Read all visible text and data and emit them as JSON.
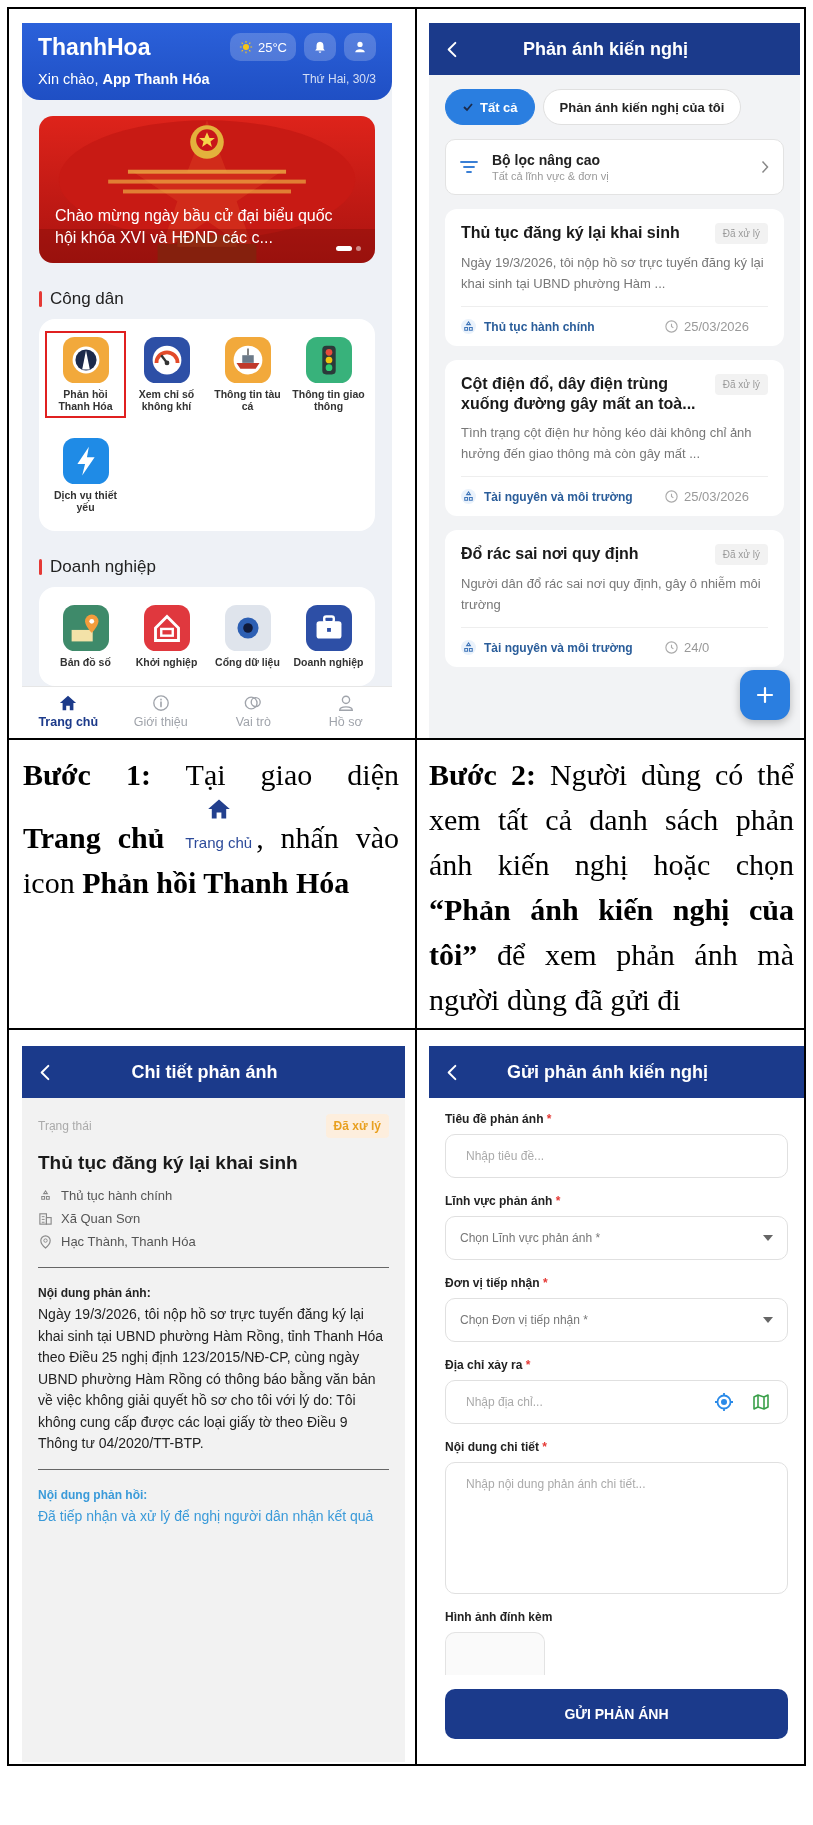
{
  "home_screen": {
    "app_title": "ThanhHoa",
    "weather": "25°C",
    "greeting": "Xin chào, **App Thanh Hóa**",
    "date": "Thứ Hai, 30/3",
    "banner": {
      "kind": "picture",
      "caption": "Chào mừng ngày bầu cử đại biểu quốc hội khóa XVI và HĐND các c...",
      "slides": [
        {
          "selected": true
        },
        {
          "selected": false
        }
      ]
    },
    "sections": [
      {
        "title": "Công dân",
        "services": [
          {
            "label": "Phản hồi Thanh Hóa",
            "highlighted": true,
            "color": "#f2a93b"
          },
          {
            "label": "Xem chỉ số không khí",
            "highlighted": false,
            "color": "#2d4fa6"
          },
          {
            "label": "Thông tin tàu cá",
            "highlighted": false,
            "color": "#f2a93b"
          },
          {
            "label": "Thông tin giao thông",
            "highlighted": false,
            "color": "#38b27b"
          },
          {
            "label": "Dịch vụ thiết yếu",
            "highlighted": false,
            "color": "#1f8be6"
          }
        ]
      },
      {
        "title": "Doanh nghiệp",
        "services": [
          {
            "label": "Bản đồ số",
            "highlighted": false,
            "color": "#3e8a6a"
          },
          {
            "label": "Khởi nghiệp",
            "highlighted": false,
            "color": "#e0383e"
          },
          {
            "label": "Cổng dữ liệu",
            "highlighted": false,
            "color": "#dfe4ec"
          },
          {
            "label": "Doanh nghiệp",
            "highlighted": false,
            "color": "#2d4fa6"
          }
        ]
      }
    ],
    "nav": [
      {
        "label": "Trang chủ",
        "selected": true
      },
      {
        "label": "Giới thiệu",
        "selected": false
      },
      {
        "label": "Vai trò",
        "selected": false
      },
      {
        "label": "Hồ sơ",
        "selected": false
      }
    ]
  },
  "list_screen": {
    "title": "Phản ánh kiến nghị",
    "filters": [
      {
        "label": "Tất cả",
        "selected": true
      },
      {
        "label": "Phản ánh kiến nghị của tôi",
        "selected": false
      }
    ],
    "advanced_filter": {
      "title": "Bộ lọc nâng cao",
      "subtitle": "Tất cả lĩnh vực & đơn vị"
    },
    "reports": [
      {
        "title": "Thủ tục đăng ký lại khai sinh",
        "status": "Đã xử lý",
        "summary": "Ngày 19/3/2026, tôi nộp hồ sơ trực tuyến đăng ký lại khai sinh tại UBND phường Hàm ...",
        "category": "Thủ tục hành chính",
        "date": "25/03/2026"
      },
      {
        "title": "Cột điện đổ, dây điện trùng xuống đường gây mất an toà...",
        "status": "Đã xử lý",
        "summary": "Tình trạng cột điện hư hỏng kéo dài không chỉ ảnh hưởng đến giao thông mà còn gây mất ...",
        "category": "Tài nguyên và môi trường",
        "date": "25/03/2026"
      },
      {
        "title": "Đổ rác sai nơi quy định",
        "status": "Đã xử lý",
        "summary": "Người dân đổ rác sai nơi quy định, gây ô nhiễm môi trường",
        "category": "Tài nguyên và môi trường",
        "date": "24/0"
      }
    ]
  },
  "step_1": {
    "before": "**Bước 1:** Tại giao diện",
    "middle": "**Trang chủ**",
    "image_label": "Trang chủ",
    "after": ", nhấn vào icon **Phản hồi Thanh Hóa**"
  },
  "step_2": {
    "text": "**Bước 2:** Người dùng có thể xem tất cả danh sách phản ánh kiến nghị hoặc chọn **“Phản ánh kiến nghị của tôi”** để xem phản ánh mà người dùng đã gửi đi"
  },
  "detail_screen": {
    "title": "Chi tiết phản ánh",
    "status_label": "Trạng thái",
    "status": "Đã xử lý",
    "report_title": "Thủ tục đăng ký lại khai sinh",
    "meta": [
      "Thủ tục hành chính",
      "Xã Quan Sơn",
      "Hạc Thành, Thanh Hóa"
    ],
    "content_label": "Nội dung phản ánh:",
    "content": "Ngày 19/3/2026, tôi nộp hồ sơ trực tuyến đăng ký lại khai sinh tại UBND phường Hàm Rồng, tỉnh Thanh Hóa theo Điều 25 nghị định 123/2015/NĐ-CP, cùng ngày UBND phường Hàm Rồng có thông báo bằng văn bản về việc không giải quyết hồ sơ cho tôi với lý do: Tôi không cung cấp được các loại giấy tờ theo Điều 9 Thông tư 04/2020/TT-BTP.",
    "reply_label": "Nội dung phản hồi:",
    "reply": "Đã tiếp nhận và xử lý để nghị người dân nhận kết quả"
  },
  "form_screen": {
    "title": "Gửi phản ánh kiến nghị",
    "fields": [
      {
        "kind": "text",
        "label": "Tiêu đề phản ánh",
        "required_mark": "*",
        "placeholder": "Nhập tiêu đề..."
      },
      {
        "kind": "select",
        "label": "Lĩnh vực phản ánh",
        "required_mark": "*",
        "placeholder": "Chọn Lĩnh vực phản ánh *"
      },
      {
        "kind": "select",
        "label": "Đơn vị tiếp nhận",
        "required_mark": "*",
        "placeholder": "Chọn Đơn vị tiếp nhận *"
      },
      {
        "kind": "address",
        "label": "Địa chỉ xảy ra",
        "required_mark": "*",
        "placeholder": "Nhập địa chỉ..."
      },
      {
        "kind": "textarea",
        "label": "Nội dung chi tiết",
        "required_mark": "*",
        "placeholder": "Nhập nội dung phản ánh chi tiết..."
      },
      {
        "label": "Hình ảnh đính kèm"
      }
    ],
    "submit": "GỬI PHẢN ÁNH"
  }
}
